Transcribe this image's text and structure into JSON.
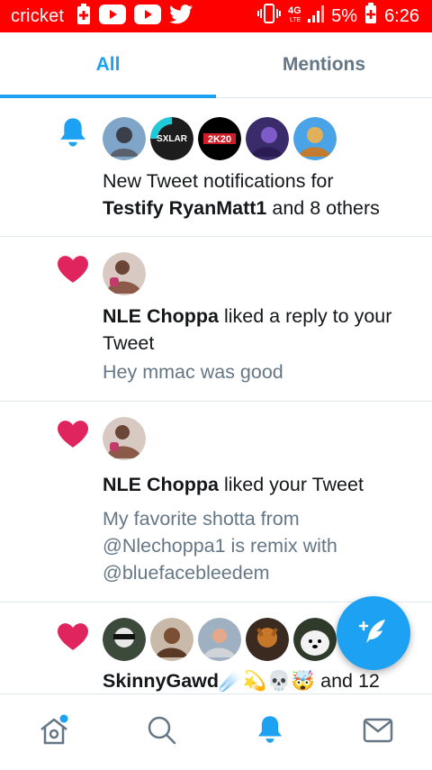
{
  "status_bar": {
    "carrier": "cricket",
    "battery": "5%",
    "time": "6:26",
    "network": "4G LTE"
  },
  "tabs": [
    {
      "label": "All",
      "active": true
    },
    {
      "label": "Mentions",
      "active": false
    }
  ],
  "colors": {
    "accent": "#1da1f2",
    "like": "#e0245e",
    "status_bar": "#ff0000",
    "secondary_text": "#657786"
  },
  "notifications": [
    {
      "type": "bell-icon",
      "avatar_count": 5,
      "text_prefix": "New Tweet notifications for",
      "names": "Testify RyanMatt1",
      "text_suffix": "and 8 others"
    },
    {
      "type": "heart-icon",
      "name": "NLE Choppa",
      "action": "liked a reply to your Tweet",
      "tweet": "Hey mmac was good"
    },
    {
      "type": "heart-icon",
      "name": "NLE Choppa",
      "action": "liked your Tweet",
      "tweet": "My favorite shotta from @Nlechoppa1 is remix with @bluefacebleedem"
    },
    {
      "type": "heart-icon",
      "avatar_count": 5,
      "name": "SkinnyGawd☄️💫💀🤯",
      "action": "and 12"
    }
  ],
  "bottom_nav": [
    {
      "icon": "home-icon",
      "has_dot": true
    },
    {
      "icon": "search-icon"
    },
    {
      "icon": "notifications-bell-icon",
      "active": true
    },
    {
      "icon": "messages-mail-icon"
    }
  ],
  "fab": {
    "icon": "compose-tweet-icon"
  }
}
